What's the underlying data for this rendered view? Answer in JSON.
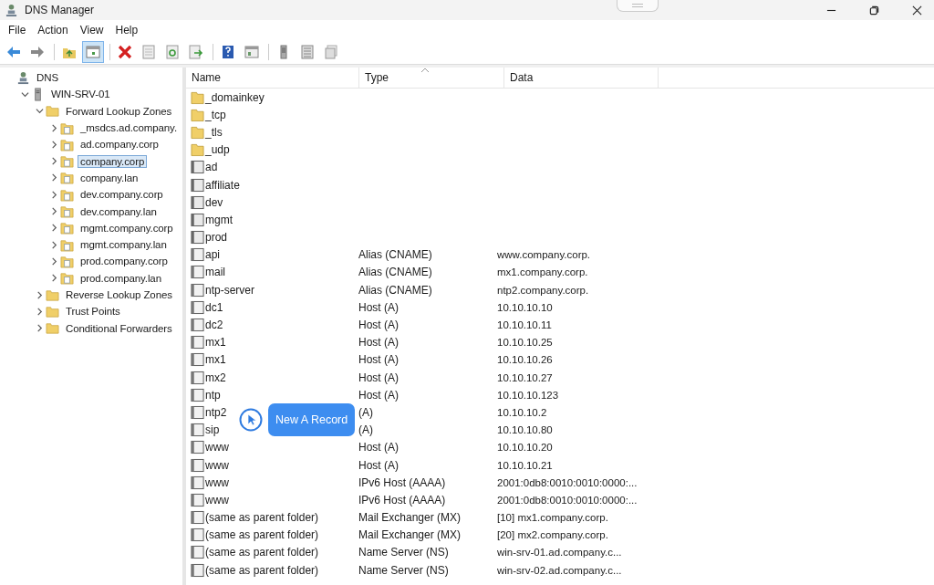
{
  "window": {
    "title": "DNS Manager"
  },
  "menu": [
    "File",
    "Action",
    "View",
    "Help"
  ],
  "toolbar": [
    [
      {
        "kind": "back",
        "pressed": false
      },
      {
        "kind": "forward",
        "pressed": false
      }
    ],
    [
      {
        "kind": "up",
        "pressed": false
      },
      {
        "kind": "tree",
        "pressed": true
      }
    ],
    [
      {
        "kind": "delete",
        "pressed": false
      },
      {
        "kind": "properties",
        "pressed": false
      },
      {
        "kind": "refresh",
        "pressed": false
      },
      {
        "kind": "export",
        "pressed": false
      }
    ],
    [
      {
        "kind": "help",
        "pressed": false
      },
      {
        "kind": "console",
        "pressed": false
      }
    ],
    [
      {
        "kind": "server",
        "pressed": false
      },
      {
        "kind": "list",
        "pressed": false
      },
      {
        "kind": "records",
        "pressed": false
      }
    ]
  ],
  "tree": [
    {
      "label": "DNS",
      "kind": "root",
      "selected": false,
      "children": [
        {
          "label": "WIN-SRV-01",
          "kind": "server",
          "expanded": true,
          "selected": false,
          "children": [
            {
              "label": "Forward Lookup Zones",
              "kind": "folder",
              "expanded": true,
              "selected": false,
              "children": [
                {
                  "label": "_msdcs.ad.company.",
                  "kind": "zone",
                  "expanded": false,
                  "selected": false
                },
                {
                  "label": "ad.company.corp",
                  "kind": "zone",
                  "expanded": false,
                  "selected": false
                },
                {
                  "label": "company.corp",
                  "kind": "zone",
                  "expanded": false,
                  "selected": true
                },
                {
                  "label": "company.lan",
                  "kind": "zone",
                  "expanded": false,
                  "selected": false
                },
                {
                  "label": "dev.company.corp",
                  "kind": "zone",
                  "expanded": false,
                  "selected": false
                },
                {
                  "label": "dev.company.lan",
                  "kind": "zone",
                  "expanded": false,
                  "selected": false
                },
                {
                  "label": "mgmt.company.corp",
                  "kind": "zone",
                  "expanded": false,
                  "selected": false
                },
                {
                  "label": "mgmt.company.lan",
                  "kind": "zone",
                  "expanded": false,
                  "selected": false
                },
                {
                  "label": "prod.company.corp",
                  "kind": "zone",
                  "expanded": false,
                  "selected": false
                },
                {
                  "label": "prod.company.lan",
                  "kind": "zone",
                  "expanded": false,
                  "selected": false
                }
              ]
            },
            {
              "label": "Reverse Lookup Zones",
              "kind": "folder",
              "expanded": false,
              "selected": false
            },
            {
              "label": "Trust Points",
              "kind": "folder",
              "expanded": false,
              "selected": false
            },
            {
              "label": "Conditional Forwarders",
              "kind": "folder",
              "expanded": false,
              "selected": false
            }
          ]
        }
      ]
    }
  ],
  "table": {
    "columns": [
      "Name",
      "Type",
      "Data"
    ],
    "rows": [
      {
        "kind": "folder",
        "name": "_domainkey"
      },
      {
        "kind": "folder",
        "name": "_tcp"
      },
      {
        "kind": "folder",
        "name": "_tls"
      },
      {
        "kind": "folder",
        "name": "_udp"
      },
      {
        "kind": "domain",
        "name": "ad"
      },
      {
        "kind": "domain",
        "name": "affiliate"
      },
      {
        "kind": "domain",
        "name": "dev"
      },
      {
        "kind": "domain",
        "name": "mgmt"
      },
      {
        "kind": "domain",
        "name": "prod"
      },
      {
        "kind": "record",
        "name": "api",
        "type": "Alias (CNAME)",
        "data": "www.company.corp."
      },
      {
        "kind": "record",
        "name": "mail",
        "type": "Alias (CNAME)",
        "data": "mx1.company.corp."
      },
      {
        "kind": "record",
        "name": "ntp-server",
        "type": "Alias (CNAME)",
        "data": "ntp2.company.corp."
      },
      {
        "kind": "record",
        "name": "dc1",
        "type": "Host (A)",
        "data": "10.10.10.10"
      },
      {
        "kind": "record",
        "name": "dc2",
        "type": "Host (A)",
        "data": "10.10.10.11"
      },
      {
        "kind": "record",
        "name": "mx1",
        "type": "Host (A)",
        "data": "10.10.10.25"
      },
      {
        "kind": "record",
        "name": "mx1",
        "type": "Host (A)",
        "data": "10.10.10.26"
      },
      {
        "kind": "record",
        "name": "mx2",
        "type": "Host (A)",
        "data": "10.10.10.27"
      },
      {
        "kind": "record",
        "name": "ntp",
        "type": "Host (A)",
        "data": "10.10.10.123"
      },
      {
        "kind": "record",
        "name": "ntp2",
        "type": "(A)",
        "data": "10.10.10.2"
      },
      {
        "kind": "record",
        "name": "sip",
        "type": "(A)",
        "data": "10.10.10.80"
      },
      {
        "kind": "record",
        "name": "www",
        "type": "Host (A)",
        "data": "10.10.10.20"
      },
      {
        "kind": "record",
        "name": "www",
        "type": "Host (A)",
        "data": "10.10.10.21"
      },
      {
        "kind": "record",
        "name": "www",
        "type": "IPv6 Host (AAAA)",
        "data": "2001:0db8:0010:0010:0000:..."
      },
      {
        "kind": "record",
        "name": "www",
        "type": "IPv6 Host (AAAA)",
        "data": "2001:0db8:0010:0010:0000:..."
      },
      {
        "kind": "record",
        "name": "(same as parent folder)",
        "type": "Mail Exchanger (MX)",
        "data": "[10]  mx1.company.corp."
      },
      {
        "kind": "record",
        "name": "(same as parent folder)",
        "type": "Mail Exchanger (MX)",
        "data": "[20]  mx2.company.corp."
      },
      {
        "kind": "record",
        "name": "(same as parent folder)",
        "type": "Name Server (NS)",
        "data": "win-srv-01.ad.company.c..."
      },
      {
        "kind": "record",
        "name": "(same as parent folder)",
        "type": "Name Server (NS)",
        "data": "win-srv-02.ad.company.c..."
      }
    ]
  },
  "tooltip": {
    "text": "New A Record"
  }
}
